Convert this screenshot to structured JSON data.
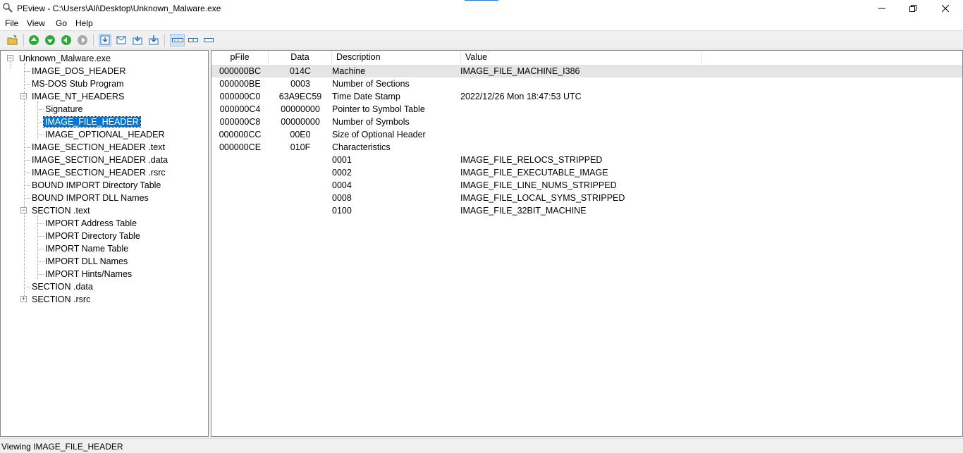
{
  "window": {
    "title": "PEview - C:\\Users\\Ali\\Desktop\\Unknown_Malware.exe"
  },
  "menu": [
    "File",
    "View",
    "Go",
    "Help"
  ],
  "toolbar": {
    "icons": [
      "open-folder-icon",
      "go-up-icon",
      "go-down-icon",
      "back-icon",
      "forward-icon",
      "view-hex-icon",
      "view-doc-icon",
      "view-export-icon",
      "view-save-icon",
      "layout-wide-icon",
      "layout-split-icon",
      "layout-narrow-icon"
    ]
  },
  "tree": {
    "root": "Unknown_Malware.exe",
    "items": [
      "IMAGE_DOS_HEADER",
      "MS-DOS Stub Program",
      "IMAGE_NT_HEADERS",
      "Signature",
      "IMAGE_FILE_HEADER",
      "IMAGE_OPTIONAL_HEADER",
      "IMAGE_SECTION_HEADER .text",
      "IMAGE_SECTION_HEADER .data",
      "IMAGE_SECTION_HEADER .rsrc",
      "BOUND IMPORT Directory Table",
      "BOUND IMPORT DLL Names",
      "SECTION .text",
      "IMPORT Address Table",
      "IMPORT Directory Table",
      "IMPORT Name Table",
      "IMPORT DLL Names",
      "IMPORT Hints/Names",
      "SECTION .data",
      "SECTION .rsrc"
    ],
    "selected": "IMAGE_FILE_HEADER"
  },
  "list": {
    "columns": [
      "pFile",
      "Data",
      "Description",
      "Value"
    ],
    "rows": [
      [
        "000000BC",
        "014C",
        "Machine",
        "IMAGE_FILE_MACHINE_I386"
      ],
      [
        "000000BE",
        "0003",
        "Number of Sections",
        ""
      ],
      [
        "000000C0",
        "63A9EC59",
        "Time Date Stamp",
        "2022/12/26 Mon 18:47:53 UTC"
      ],
      [
        "000000C4",
        "00000000",
        "Pointer to Symbol Table",
        ""
      ],
      [
        "000000C8",
        "00000000",
        "Number of Symbols",
        ""
      ],
      [
        "000000CC",
        "00E0",
        "Size of Optional Header",
        ""
      ],
      [
        "000000CE",
        "010F",
        "Characteristics",
        ""
      ],
      [
        "",
        "",
        "0001",
        "IMAGE_FILE_RELOCS_STRIPPED"
      ],
      [
        "",
        "",
        "0002",
        "IMAGE_FILE_EXECUTABLE_IMAGE"
      ],
      [
        "",
        "",
        "0004",
        "IMAGE_FILE_LINE_NUMS_STRIPPED"
      ],
      [
        "",
        "",
        "0008",
        "IMAGE_FILE_LOCAL_SYMS_STRIPPED"
      ],
      [
        "",
        "",
        "0100",
        "IMAGE_FILE_32BIT_MACHINE"
      ]
    ]
  },
  "status": {
    "text": "Viewing IMAGE_FILE_HEADER"
  }
}
